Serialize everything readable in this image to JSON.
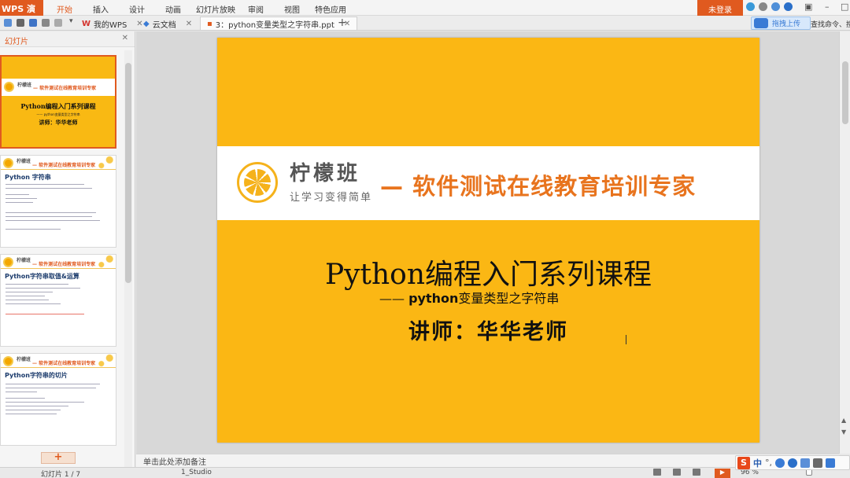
{
  "app": {
    "name": "WPS 演示",
    "menu": [
      "开始",
      "插入",
      "设计",
      "动画",
      "幻灯片放映",
      "审阅",
      "视图",
      "特色应用"
    ],
    "login": "未登录"
  },
  "tabs": [
    {
      "label": "我的WPS"
    },
    {
      "label": "云文档"
    },
    {
      "label": "3：python变量类型之字符串.ppt"
    }
  ],
  "toolbar": {
    "upload_label": "拖拽上传",
    "find_label": "查找命令、搜"
  },
  "left_pane": {
    "title": "幻灯片",
    "add_label": "+"
  },
  "thumbnails": [
    {
      "title": "Python编程入门系列课程",
      "sub": "—— python变量类型之字符串",
      "teacher": "讲师：华华老师",
      "brand": "柠檬班",
      "tag": "— 软件测试在线教育培训专家"
    },
    {
      "heading": "Python 字符串",
      "brand": "柠檬班",
      "tag": "— 软件测试在线教育培训专家"
    },
    {
      "heading": "Python字符串取值&运算",
      "brand": "柠檬班",
      "tag": "— 软件测试在线教育培训专家"
    },
    {
      "heading": "Python字符串的切片",
      "brand": "柠檬班",
      "tag": "— 软件测试在线教育培训专家"
    }
  ],
  "slide": {
    "brand": "柠檬班",
    "brand_sub": "让学习变得简单",
    "tagline": "— 软件测试在线教育培训专家",
    "course_title": "Python编程入门系列课程",
    "subtitle_dash": "——",
    "subtitle_bold": "python",
    "subtitle_rest": "变量类型之字符串",
    "teacher": "讲师：华华老师"
  },
  "notes": {
    "placeholder": "单击此处添加备注"
  },
  "status": {
    "slide_count": "幻灯片 1 / 7",
    "theme": "1_Studio",
    "zoom": "96 %"
  },
  "ime": {
    "logo": "S",
    "mode": "中"
  },
  "colors": {
    "accent": "#e05a1f",
    "slide_bg": "#fbb714",
    "tagline": "#e8741e"
  }
}
